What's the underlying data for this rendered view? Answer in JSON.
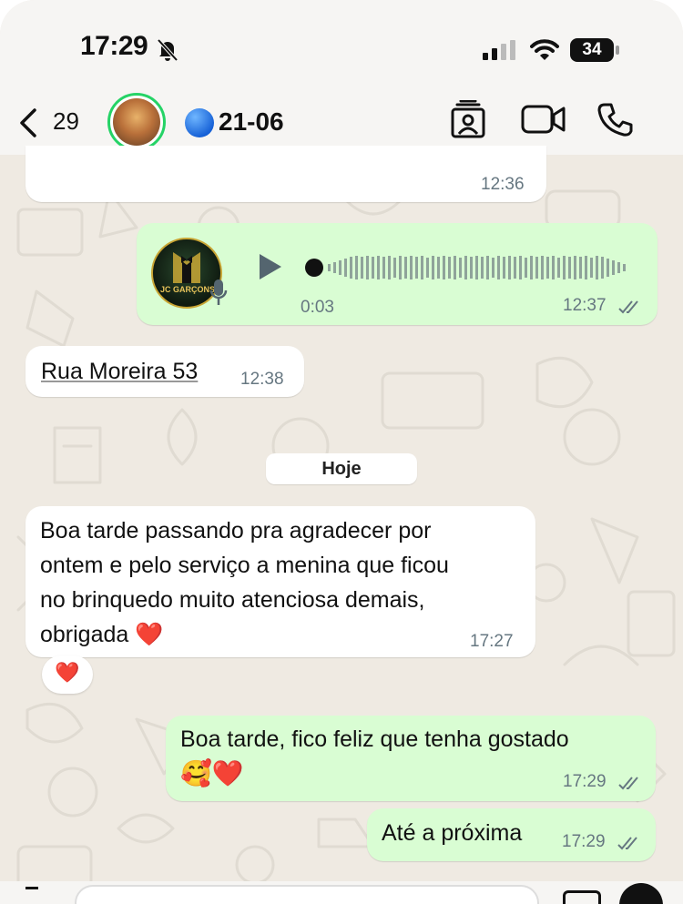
{
  "status_bar": {
    "time": "17:29",
    "battery": "34",
    "bell_icon": "bell-slash-icon"
  },
  "header": {
    "back_count": "29",
    "contact_name": "21-06",
    "status_emoji_icon": "blue-circle-icon",
    "icons": [
      "contact-card-icon",
      "video-call-icon",
      "phone-call-icon"
    ]
  },
  "messages": [
    {
      "type": "incoming-cropped",
      "time": "12:36"
    },
    {
      "type": "outgoing-voice",
      "avatar_label": "JC GARÇONS",
      "duration": "0:03",
      "time": "12:37",
      "read": true
    },
    {
      "type": "incoming",
      "text": "Rua Moreira 53",
      "time": "12:38"
    },
    {
      "type": "date-separator",
      "text": "Hoje"
    },
    {
      "type": "incoming",
      "lines": [
        "Boa tarde passando pra agradecer por",
        "ontem e pelo serviço a menina que ficou",
        "no brinquedo muito atenciosa demais,",
        "obrigada ❤️"
      ],
      "time": "17:27",
      "reaction": "❤️"
    },
    {
      "type": "outgoing",
      "lines": [
        "Boa tarde, fico feliz que tenha gostado",
        "🥰❤️"
      ],
      "time": "17:29",
      "read": true
    },
    {
      "type": "outgoing",
      "text": "Até a próxima",
      "time": "17:29",
      "read": true
    }
  ],
  "colors": {
    "incoming": "#ffffff",
    "outgoing": "#d9fdd3",
    "background": "#efeae2",
    "ticks": "#667781"
  }
}
